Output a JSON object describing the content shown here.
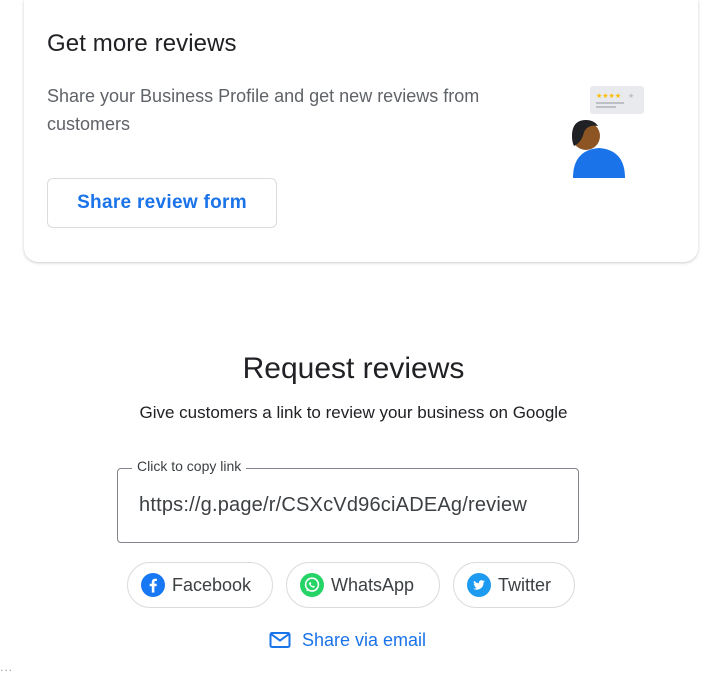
{
  "card": {
    "title": "Get more reviews",
    "description": "Share your Business Profile and get new reviews from customers",
    "button_label": "Share review form"
  },
  "request": {
    "title": "Request reviews",
    "subtitle": "Give customers a link to review your business on Google",
    "link_label": "Click to copy link",
    "link_value": "https://g.page/r/CSXcVd96ciADEAg/review",
    "share_buttons": [
      {
        "label": "Facebook",
        "icon": "facebook-icon",
        "color": "#1877f2"
      },
      {
        "label": "WhatsApp",
        "icon": "whatsapp-icon",
        "color": "#25d366"
      },
      {
        "label": "Twitter",
        "icon": "twitter-icon",
        "color": "#1d9bf0"
      }
    ],
    "email_label": "Share via email"
  },
  "footer": {
    "dots": "..."
  },
  "colors": {
    "accent": "#1a73e8",
    "text_primary": "#202124",
    "text_secondary": "#5f6368",
    "border": "#dadce0"
  }
}
